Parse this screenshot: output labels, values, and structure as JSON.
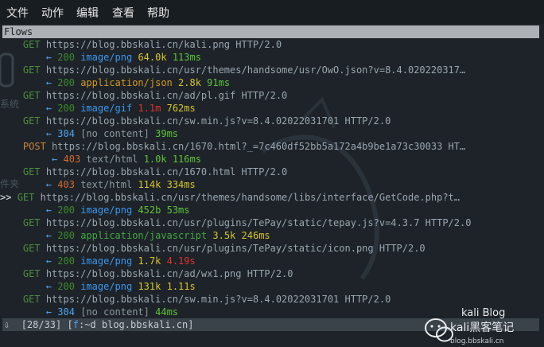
{
  "menu": {
    "items": [
      "文件",
      "动作",
      "编辑",
      "查看",
      "帮助"
    ]
  },
  "background": {
    "desktop_labels": [
      "系统",
      "件夹"
    ]
  },
  "panel": {
    "title": "Flows"
  },
  "flows": [
    {
      "method": "GET",
      "url": "https://blog.bbskali.cn/kali.png HTTP/2.0",
      "status": "200",
      "content_type": "image/png",
      "size": "64.0k",
      "time": "113ms",
      "ct_color": "blue",
      "size_color": "yellow",
      "time_color": "green"
    },
    {
      "method": "GET",
      "url": "https://blog.bbskali.cn/usr/themes/handsome/usr/OwO.json?v=8.4.020220317…",
      "status": "200",
      "content_type": "application/json",
      "size": "2.8k",
      "time": "91ms",
      "ct_color": "orange",
      "size_color": "yellow",
      "time_color": "green"
    },
    {
      "method": "GET",
      "url": "https://blog.bbskali.cn/ad/pl.gif HTTP/2.0",
      "status": "200",
      "content_type": "image/gif",
      "size": "1.1m",
      "time": "762ms",
      "ct_color": "blue",
      "size_color": "red",
      "time_color": "yellow"
    },
    {
      "method": "GET",
      "url": "https://blog.bbskali.cn/sw.min.js?v=8.4.02022031701 HTTP/2.0",
      "status": "304",
      "content_type": "[no content]",
      "size": "",
      "time": "39ms",
      "ct_color": "grey",
      "size_color": "yellow",
      "time_color": "green"
    },
    {
      "method": "POST",
      "url": "https://blog.bbskali.cn/1670.html?_=7c460df52bb5a172a4b9be1a73c30033 HT…",
      "status": "403",
      "content_type": "text/html",
      "size": "1.0k",
      "time": "116ms",
      "ct_color": "grey",
      "size_color": "green",
      "time_color": "green",
      "indent": true
    },
    {
      "method": "GET",
      "url": "https://blog.bbskali.cn/1670.html HTTP/2.0",
      "status": "403",
      "content_type": "text/html",
      "size": "114k",
      "time": "334ms",
      "ct_color": "grey",
      "size_color": "yellow",
      "time_color": "yellow"
    },
    {
      "method": "GET",
      "url": "https://blog.bbskali.cn/usr/themes/handsome/libs/interface/GetCode.php?t…",
      "status": "200",
      "content_type": "image/png",
      "size": "452b",
      "time": "53ms",
      "ct_color": "blue",
      "size_color": "green",
      "time_color": "green",
      "selected": true
    },
    {
      "method": "GET",
      "url": "https://blog.bbskali.cn/usr/plugins/TePay/static/tepay.js?v=4.3.7 HTTP/2.0",
      "status": "200",
      "content_type": "application/javascript",
      "size": "3.5k",
      "time": "246ms",
      "ct_color": "green",
      "size_color": "yellow",
      "time_color": "yellow"
    },
    {
      "method": "GET",
      "url": "https://blog.bbskali.cn/usr/plugins/TePay/static/icon.png HTTP/2.0",
      "status": "200",
      "content_type": "image/png",
      "size": "1.7k",
      "time": "4.19s",
      "ct_color": "blue",
      "size_color": "yellow",
      "time_color": "red"
    },
    {
      "method": "GET",
      "url": "https://blog.bbskali.cn/ad/wx1.png HTTP/2.0",
      "status": "200",
      "content_type": "image/png",
      "size": "131k",
      "time": "1.11s",
      "ct_color": "blue",
      "size_color": "yellow",
      "time_color": "yellow"
    },
    {
      "method": "GET",
      "url": "https://blog.bbskali.cn/sw.min.js?v=8.4.02022031701 HTTP/2.0",
      "status": "304",
      "content_type": "[no content]",
      "size": "",
      "time": "44ms",
      "ct_color": "grey",
      "size_color": "yellow",
      "time_color": "green"
    }
  ],
  "cursor_marker": ">>",
  "arrow": "←",
  "statusbar": {
    "icon": "⇩",
    "position": "[28/33]",
    "filter_open": "[",
    "filter_key": "f",
    "filter_text": ":~d blog.bbskali.cn]"
  },
  "watermark": {
    "line1": "kali Blog",
    "line2": "kali黑客笔记",
    "line3": "blog.bbskali.cn"
  }
}
